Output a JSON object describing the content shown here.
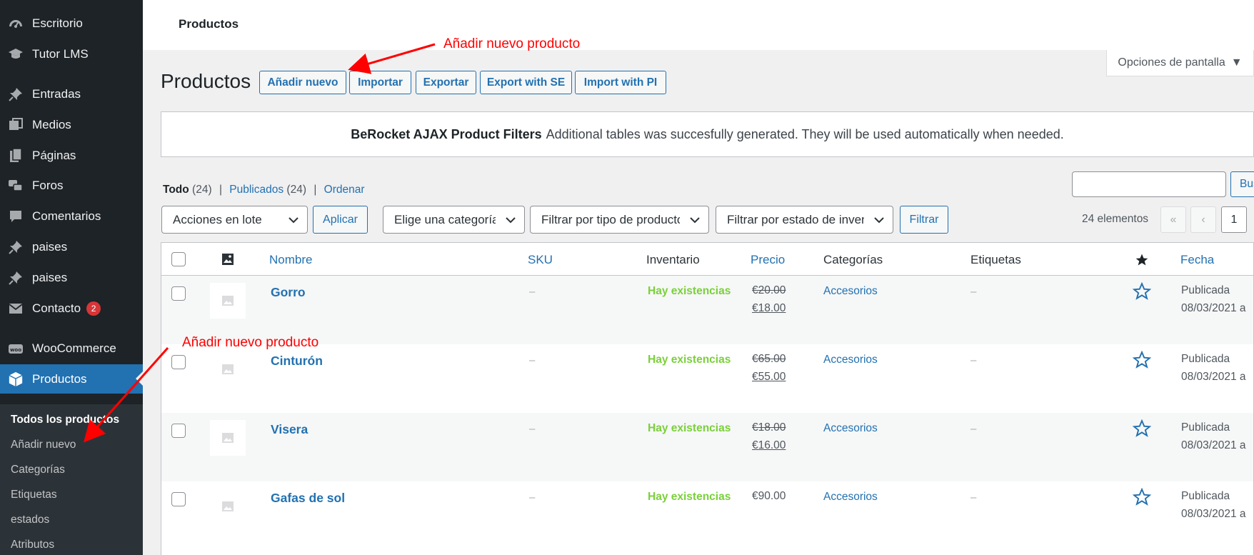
{
  "sidebar": {
    "items": [
      {
        "label": "Escritorio",
        "icon": "dashboard-icon"
      },
      {
        "label": "Tutor LMS",
        "icon": "graduation-cap-icon"
      },
      {
        "label": "Entradas",
        "icon": "pushpin-icon"
      },
      {
        "label": "Medios",
        "icon": "media-icon"
      },
      {
        "label": "Páginas",
        "icon": "pages-icon"
      },
      {
        "label": "Foros",
        "icon": "forums-icon"
      },
      {
        "label": "Comentarios",
        "icon": "comment-icon"
      },
      {
        "label": "paises",
        "icon": "pushpin-icon"
      },
      {
        "label": "paises",
        "icon": "pushpin-icon"
      },
      {
        "label": "Contacto",
        "icon": "mail-icon",
        "badge": "2"
      },
      {
        "label": "WooCommerce",
        "icon": "woo-icon"
      },
      {
        "label": "Productos",
        "icon": "box-icon"
      }
    ],
    "submenu": [
      "Todos los productos",
      "Añadir nuevo",
      "Categorías",
      "Etiquetas",
      "estados",
      "Atributos"
    ]
  },
  "header": {
    "title": "Productos",
    "screen_options": "Opciones de pantalla"
  },
  "annotations": {
    "top": "Añadir nuevo producto",
    "side": "Añadir nuevo producto"
  },
  "page": {
    "title": "Productos",
    "buttons": [
      "Añadir nuevo",
      "Importar",
      "Exportar",
      "Export with SE",
      "Import with PI"
    ]
  },
  "notice": {
    "bold": "BeRocket AJAX Product Filters",
    "text": "Additional tables was succesfully generated. They will be used automatically when needed."
  },
  "views": {
    "all_label": "Todo",
    "all_count": "(24)",
    "published_label": "Publicados",
    "published_count": "(24)",
    "sort_label": "Ordenar"
  },
  "search": {
    "button": "Buscar productos"
  },
  "filters": {
    "bulk": "Acciones en lote",
    "apply": "Aplicar",
    "category": "Elige una categoría",
    "type": "Filtrar por tipo de producto",
    "stock": "Filtrar por estado de inventario",
    "filter_btn": "Filtrar"
  },
  "pagination": {
    "count": "24 elementos",
    "first": "«",
    "prev": "‹",
    "current": "1"
  },
  "table": {
    "columns": {
      "name": "Nombre",
      "sku": "SKU",
      "stock": "Inventario",
      "price": "Precio",
      "categories": "Categorías",
      "tags": "Etiquetas",
      "date": "Fecha"
    },
    "rows": [
      {
        "name": "Gorro",
        "sku": "–",
        "stock": "Hay existencias",
        "price_old": "€20.00",
        "price_new": "€18.00",
        "category": "Accesorios",
        "tags": "–",
        "date_status": "Publicada",
        "date": "08/03/2021 a"
      },
      {
        "name": "Cinturón",
        "sku": "–",
        "stock": "Hay existencias",
        "price_old": "€65.00",
        "price_new": "€55.00",
        "category": "Accesorios",
        "tags": "–",
        "date_status": "Publicada",
        "date": "08/03/2021 a"
      },
      {
        "name": "Visera",
        "sku": "–",
        "stock": "Hay existencias",
        "price_old": "€18.00",
        "price_new": "€16.00",
        "category": "Accesorios",
        "tags": "–",
        "date_status": "Publicada",
        "date": "08/03/2021 a"
      },
      {
        "name": "Gafas de sol",
        "sku": "–",
        "stock": "Hay existencias",
        "price_old": "",
        "price_new": "€90.00",
        "category": "Accesorios",
        "tags": "–",
        "date_status": "Publicada",
        "date": "08/03/2021 a"
      }
    ]
  },
  "colors": {
    "sidebar_bg": "#1d2327",
    "active_bg": "#2271b1",
    "link": "#2271b1",
    "in_stock": "#7ad03a",
    "annotation": "#ff0000"
  }
}
